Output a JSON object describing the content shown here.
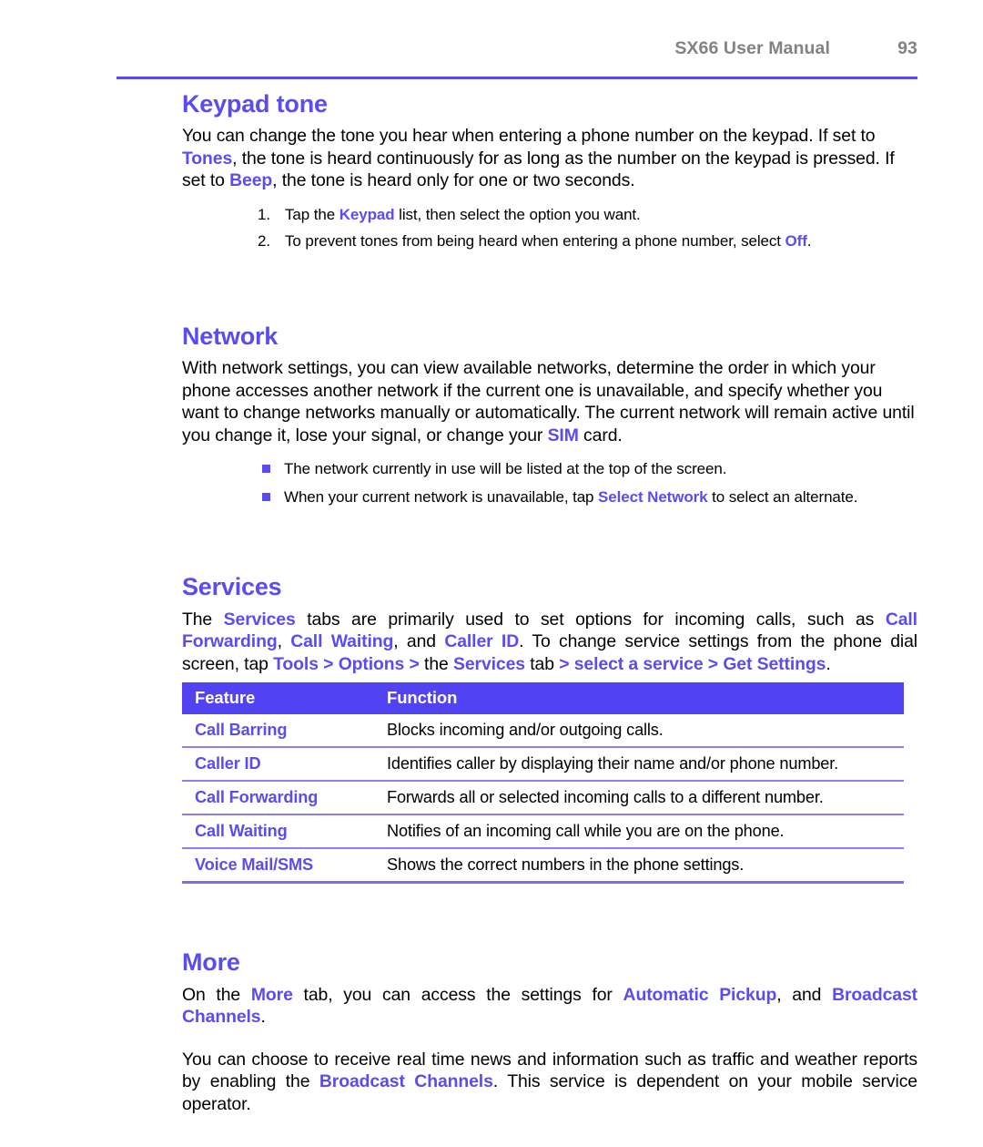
{
  "document": {
    "running_head": "SX66 User Manual",
    "page_number": "93",
    "accent_color": "#5a4cf0",
    "header_color": "#808285",
    "table_header_bg": "#5243f2"
  },
  "sections": {
    "keypad_tone": {
      "heading": "Keypad tone",
      "intro_1": "You can change the tone you hear when entering a phone number on the keypad. If set to ",
      "intro_hl_1": "Tones",
      "intro_2": ", the tone is heard continuously for as long as the number on the keypad is pressed. If set to ",
      "intro_hl_2": "Beep",
      "intro_3": ", the tone is heard only for one or two seconds.",
      "steps": [
        {
          "pre": "Tap the ",
          "hl": "Keypad",
          "post": " list, then select the option you want."
        },
        {
          "pre": "To prevent tones from being heard when entering a phone number, select ",
          "hl": "Off",
          "post": "."
        }
      ]
    },
    "network": {
      "heading": "Network",
      "intro_1": "With network settings, you can view available networks, determine the order in which your phone accesses another network if the current one is unavailable, and specify whether you want to change networks manually or automatically. The current network will remain active until you change it, lose your signal, or change your ",
      "intro_hl_1": "SIM",
      "intro_2": " card.",
      "bullets": [
        {
          "pre": "The network currently in use will be listed at the top of the screen.",
          "hl": "",
          "post": ""
        },
        {
          "pre": "When your current network is unavailable, tap ",
          "hl": "Select Network",
          "post": " to select an alternate."
        }
      ]
    },
    "services": {
      "heading": "Services",
      "intro_p1": "The ",
      "intro_hl1": "Services",
      "intro_p2": " tabs are primarily used to set options for incoming calls, such as ",
      "intro_hl2": "Call Forwarding",
      "intro_p3": ", ",
      "intro_hl3": "Call Waiting",
      "intro_p4": ", and ",
      "intro_hl4": "Caller ID",
      "intro_p5": ". To change service settings from the phone dial screen, tap ",
      "intro_hl5": "Tools > Options >",
      "intro_p6": " the ",
      "intro_hl6": "Services",
      "intro_p7": " tab ",
      "intro_hl7": "> select a service > Get Settings",
      "intro_p8": ".",
      "table": {
        "columns": [
          "Feature",
          "Function"
        ],
        "rows": [
          [
            "Call Barring",
            "Blocks incoming and/or outgoing calls."
          ],
          [
            "Caller ID",
            "Identifies caller by displaying their name and/or phone number."
          ],
          [
            "Call Forwarding",
            "Forwards all or selected incoming calls to a different number."
          ],
          [
            "Call Waiting",
            "Notifies of an incoming call while you are on the phone."
          ],
          [
            "Voice Mail/SMS",
            "Shows the correct numbers in the phone settings."
          ]
        ]
      }
    },
    "more": {
      "heading": "More",
      "p1_a": "On the ",
      "p1_hl1": "More",
      "p1_b": " tab, you can access the settings for ",
      "p1_hl2": "Automatic Pickup",
      "p1_c": ", and ",
      "p1_hl3": "Broadcast Channels",
      "p1_d": ".",
      "p2_a": "You can choose to receive real time news and information such as traffic and weather reports by enabling the ",
      "p2_hl1": "Broadcast Channels",
      "p2_b": ". This service is dependent on your mobile service operator."
    }
  }
}
